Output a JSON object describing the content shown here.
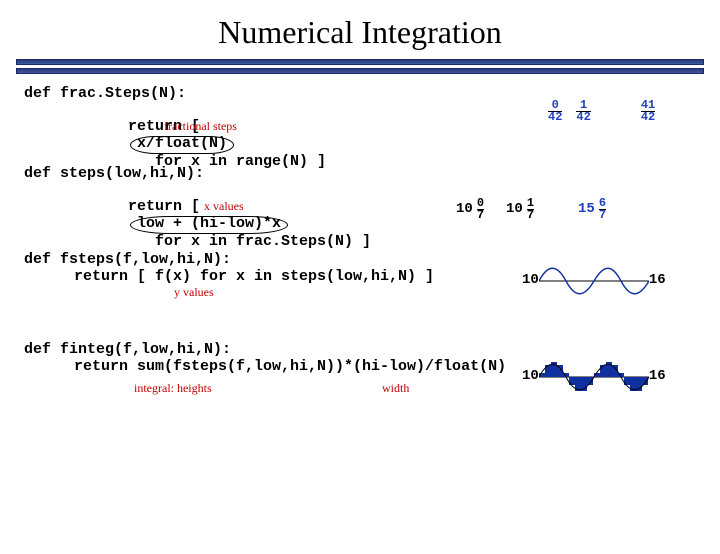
{
  "title": "Numerical Integration",
  "code": {
    "b1l1": "def frac.Steps(N):",
    "b1l2a": "return [",
    "b1l2ov": "x/float(N)",
    "b1l2b": "   for x in range(N) ]",
    "b1ann": "fractional steps",
    "b2l1": "def steps(low,hi,N):",
    "b2l2a": "return [",
    "b2l2ov": "low + (hi-low)*x",
    "b2l2b": "   for x in frac.Steps(N) ]",
    "b2ann": "x values",
    "b3l1": "def fsteps(f,low,hi,N):",
    "b3l2": "return [ f(x) for x in steps(low,hi,N) ]",
    "b3ann": "y values",
    "b4l1": "def finteg(f,low,hi,N):",
    "b4l2": "return sum(fsteps(f,low,hi,N))*(hi-low)/float(N)",
    "b4ann1": "integral:  heights",
    "b4ann2": "width"
  },
  "fracs1": {
    "a_num": "0",
    "a_den": "42",
    "b_num": "1",
    "b_den": "42",
    "c_num": "41",
    "c_den": "42"
  },
  "fracs2": {
    "prefix": "10",
    "a_num": "0",
    "a_den": "7",
    "b_num": "1",
    "b_den": "7",
    "c_pre": "15",
    "c_num": "6",
    "c_den": "7"
  },
  "ends": {
    "e3_left": "10",
    "e3_right": "16",
    "e4_left": "10",
    "e4_right": "16"
  }
}
